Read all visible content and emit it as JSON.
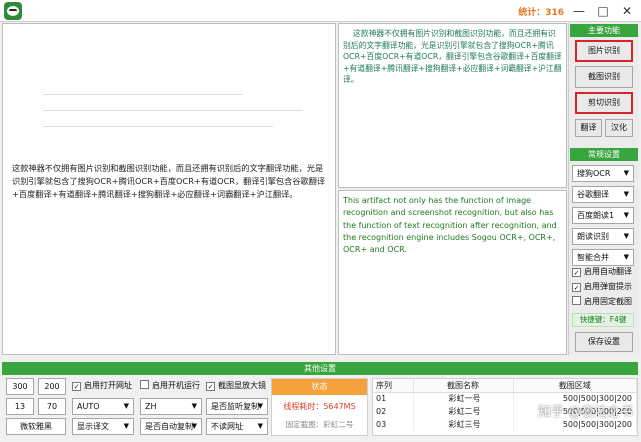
{
  "titlebar": {
    "stats": "统计：316",
    "minimize_icon": "minimize-icon",
    "maximize_icon": "maximize-icon",
    "close_icon": "close-icon"
  },
  "left_pane": {
    "text": "这款神器不仅拥有图片识别和截图识别功能，而且还拥有识别后的文字翻译功能，光是识别引擎就包含了搜狗OCR+腾讯OCR+百度OCR+有道OCR，翻译引擎包含谷歌翻译+百度翻译+有道翻译+腾讯翻译+搜狗翻译+必应翻译+词霸翻译+沪江翻译。"
  },
  "top_right_pane": {
    "text": "这款神器不仅拥有图片识别和截图识别功能，而且还拥有识别后的文字翻译功能，光是识别引擎就包含了搜狗OCR+腾讯OCR+百度OCR+有道OCR，翻译引擎包含谷歌翻译+百度翻译+有道翻译+腾讯翻译+搜狗翻译+必应翻译+词霸翻译+沪江翻译。"
  },
  "bottom_right_pane": {
    "text": "This artifact not only has the function of image recognition and screenshot recognition, but also has the function of text recognition after recognition, and the recognition engine includes Sogou OCR+, OCR+, OCR+ and OCR."
  },
  "main_functions": {
    "header": "主要功能",
    "image_recognition": "图片识别",
    "screenshot_recognition": "截图识别",
    "clip_recognition": "剪切识别",
    "translate": "翻译",
    "chinese": "汉化"
  },
  "common_settings": {
    "header": "常规设置",
    "ocr_engine": "搜狗OCR",
    "translate_engine": "谷歌翻译",
    "reading_engine": "百度朗读1",
    "read_mode": "朗读识别",
    "merge_mode": "智能合并",
    "auto_translate": "启用自动翻译",
    "popup_tip": "启用弹窗提示",
    "fixed_screenshot": "启用固定截图",
    "shortcut": "快捷键：F4键",
    "save_settings": "保存设置"
  },
  "other_settings": {
    "header": "其他设置",
    "width": "300",
    "height": "200",
    "open_url": "启用打开网址",
    "startup": "启用开机运行",
    "zoom": "截图显放大镜",
    "num1": "13",
    "num2": "70",
    "source_lang": "AUTO",
    "target_lang": "ZH",
    "listen_copy": "是否监听复制",
    "font": "微软雅黑",
    "show_translation": "显示译文",
    "auto_copy": "是否自动复制",
    "no_url": "不读网址"
  },
  "status": {
    "header": "状态",
    "time": "线程耗时：5647MS",
    "fixed": "固定截图：彩虹二号"
  },
  "table": {
    "columns": [
      "序列",
      "截图名称",
      "截图区域"
    ],
    "rows": [
      [
        "01",
        "彩虹一号",
        "500|500|300|200"
      ],
      [
        "02",
        "彩虹二号",
        "500|500|300|200"
      ],
      [
        "03",
        "彩虹三号",
        "500|500|300|200"
      ]
    ]
  },
  "watermark": "知乎 @夜法之书"
}
